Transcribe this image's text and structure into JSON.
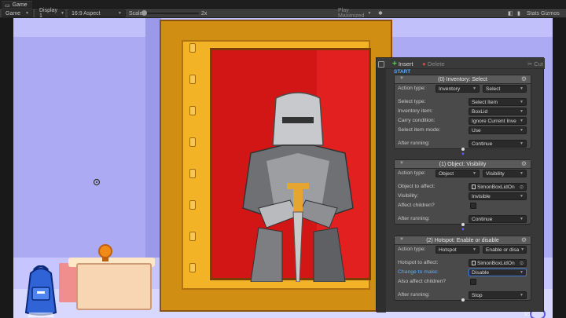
{
  "window": {
    "tab_title": "Game"
  },
  "toolbar": {
    "game_dropdown": "Game",
    "display_dropdown": "Display 1",
    "aspect_dropdown": "16:9 Aspect",
    "scale_label": "Scale",
    "scale_value": "2x",
    "play_mode_dropdown": "Play Maximized",
    "stats_label": "Stats",
    "gizmos_label": "Gizmos"
  },
  "editor": {
    "insert_label": "Insert",
    "delete_label": "Delete",
    "cut_label": "Cut",
    "start_label": "START",
    "nodes": [
      {
        "title": "(0) Inventory: Select",
        "rows": [
          {
            "label": "Action type:",
            "value": "Inventory",
            "value2": "Select"
          },
          {
            "label": "Select type:",
            "value": "Select Item"
          },
          {
            "label": "Inventory item:",
            "value": "BoxLid"
          },
          {
            "label": "Carry condition:",
            "value": "Ignore Current Inve"
          },
          {
            "label": "Select item mode:",
            "value": "Use"
          },
          {
            "label": "After running:",
            "value": "Continue"
          }
        ]
      },
      {
        "title": "(1) Object: Visibility",
        "rows": [
          {
            "label": "Action type:",
            "value": "Object",
            "value2": "Visibility"
          },
          {
            "label": "Object to affect:",
            "value": "SimonBoxLidOn"
          },
          {
            "label": "Visibility:",
            "value": "Invisible"
          },
          {
            "label": "Affect children?",
            "value": ""
          },
          {
            "label": "After running:",
            "value": "Continue"
          }
        ]
      },
      {
        "title": "(2) Hotspot: Enable or disable",
        "rows": [
          {
            "label": "Action type:",
            "value": "Hotspot",
            "value2": "Enable or disa"
          },
          {
            "label": "Hotspot to affect:",
            "value": "SimonBoxLidOn"
          },
          {
            "label": "Change to make:",
            "value": "Disable"
          },
          {
            "label": "Also affect children?",
            "value": ""
          },
          {
            "label": "After running:",
            "value": "Stop"
          }
        ]
      }
    ]
  },
  "footer": {
    "corner_value": "1/1"
  },
  "colors": {
    "start_blue": "#58a6ff",
    "insert_green": "#4fd34f",
    "painting_red": "#d21616",
    "frame_gold": "#f3b327",
    "wall": "#abaaf2"
  }
}
